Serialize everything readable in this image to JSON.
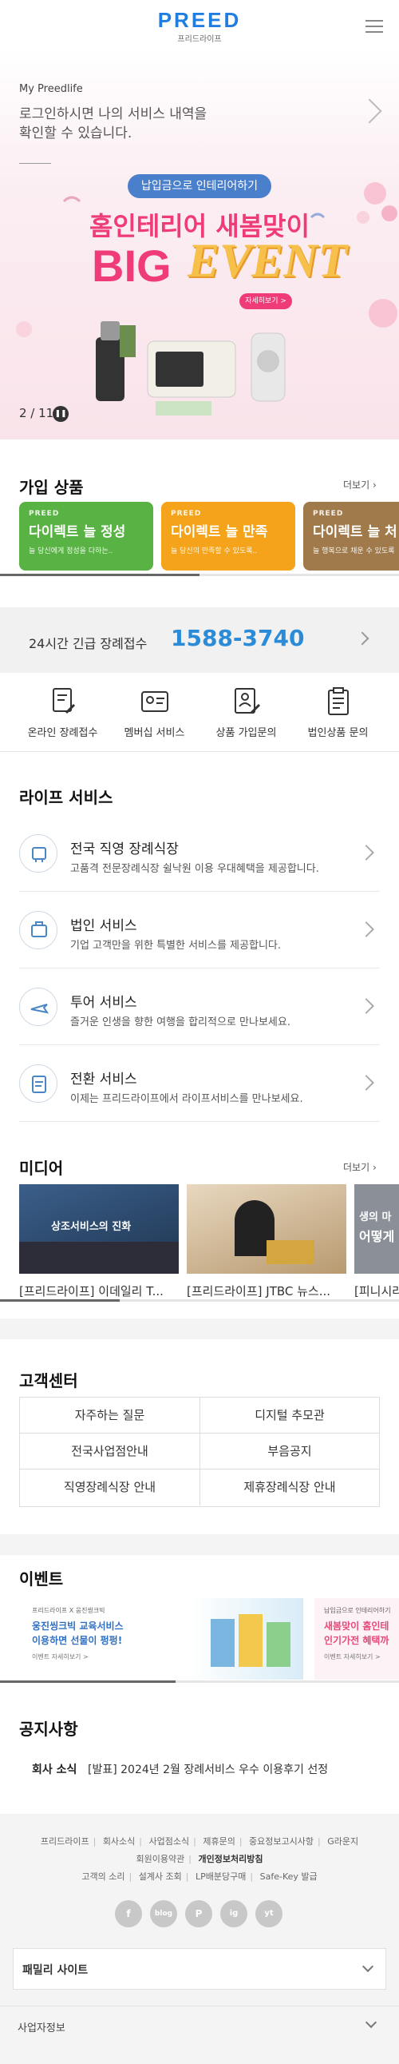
{
  "header": {
    "logo": "PREED",
    "logo_sub": "프리드라이프"
  },
  "hero": {
    "title": "My Preedlife",
    "desc_line1": "로그인하시면 나의 서비스 내역을",
    "desc_line2": "확인할 수 있습니다.",
    "banner_pill": "납입금으로 인테리어하기",
    "banner_headline": "홈인테리어 새봄맞이",
    "banner_big": "BIG",
    "banner_event": "EVENT",
    "banner_badge": "자세히보기 >",
    "counter": "2 / 11"
  },
  "products": {
    "title": "가입 상품",
    "more": "더보기",
    "cards": [
      {
        "brand": "PREED",
        "name": "다이렉트 늘 정성",
        "desc": "늘 당신에게 정성을 다하는..",
        "color": "#59b244"
      },
      {
        "brand": "PREED",
        "name": "다이렉트 늘 만족",
        "desc": "늘 당신의 만족할 수 있도록..",
        "color": "#f5a31a"
      },
      {
        "brand": "PREED",
        "name": "다이렉트 늘 처",
        "desc": "늘 행복으로 채운 수 있도록",
        "color": "#a07a4a"
      }
    ]
  },
  "emergency": {
    "label": "24시간 긴급 장례접수",
    "phone": "1588-3740"
  },
  "quickmenu": [
    {
      "label": "온라인 장례접수"
    },
    {
      "label": "멤버십 서비스"
    },
    {
      "label": "상품 가입문의"
    },
    {
      "label": "법인상품 문의"
    }
  ],
  "life": {
    "title": "라이프 서비스",
    "items": [
      {
        "title": "전국 직영 장례식장",
        "desc": "고품격 전문장례식장 쉴낙원 이용 우대혜택을 제공합니다."
      },
      {
        "title": "법인 서비스",
        "desc": "기업 고객만을 위한 특별한 서비스를 제공합니다."
      },
      {
        "title": "투어 서비스",
        "desc": "즐거운 인생을 향한 여행을 합리적으로 만나보세요."
      },
      {
        "title": "전환 서비스",
        "desc": "이제는 프리드라이프에서 라이프서비스를 만나보세요."
      }
    ]
  },
  "media": {
    "title": "미디어",
    "more": "더보기",
    "img1_text": "상조서비스의 진화",
    "img3_text": "생의 마",
    "img3_text2": "어떻게",
    "captions": [
      "[프리드라이프] 이데일리 T...",
      "[프리드라이프] JTBC 뉴스...",
      "[피니시라"
    ]
  },
  "customer": {
    "title": "고객센터",
    "cells": [
      "자주하는 질문",
      "디지털 추모관",
      "전국사업점안내",
      "부음공지",
      "직영장례식장 안내",
      "제휴장례식장 안내"
    ]
  },
  "events": {
    "title": "이벤트",
    "e1_small": "프리드라이프 X 웅진씽크빅",
    "e1_line1": "웅진씽크빅 교육서비스",
    "e1_line2": "이용하면 선물이 펑펑!",
    "e1_link": "이벤트 자세히보기 >",
    "e2_small": "납입금으로 인테리어하기",
    "e2_line1": "새봄맞이 홈인테",
    "e2_line2": "인기가전 혜택까",
    "e2_link": "이벤트 자세히보기 >"
  },
  "notice": {
    "title": "공지사항",
    "category": "회사 소식",
    "text": "[발표] 2024년 2월 장례서비스 우수 이용후기 선정"
  },
  "footer": {
    "row1": [
      "프리드라이프",
      "회사소식",
      "사업점소식",
      "제휴문의",
      "중요정보고시사항",
      "G라운지"
    ],
    "row2": [
      "회원이용약관",
      "개인정보처리방침"
    ],
    "row3": [
      "고객의 소리",
      "설계사 조회",
      "LP배분당구매",
      "Safe-Key 발급"
    ],
    "sns": [
      "f",
      "blog",
      "P",
      "ig",
      "yt"
    ],
    "family_site": "패밀리 사이트",
    "biz_info": "사업자정보"
  }
}
